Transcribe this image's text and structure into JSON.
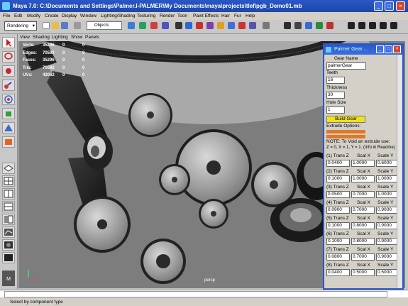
{
  "window": {
    "title": "Maya 7.0: C:\\Documents and Settings\\Palmer.I-PALMER\\My Documents\\maya\\projects\\tlef\\pgb_Demo01.mb"
  },
  "menubar": [
    "File",
    "Edit",
    "Modify",
    "Create",
    "Display",
    "Window",
    "Lighting/Shading",
    "Texturing",
    "Render",
    "Toon",
    "Paint Effects",
    "Hair",
    "Fur",
    "Help"
  ],
  "shelf": {
    "mode": "Rendering",
    "selection_field": "Objects"
  },
  "viewport": {
    "menu": [
      "View",
      "Shading",
      "Lighting",
      "Show",
      "Panels"
    ],
    "hud": [
      {
        "label": "Verts:",
        "v1": "35296",
        "v2": "0",
        "v3": "0"
      },
      {
        "label": "Edges:",
        "v1": "70592",
        "v2": "0",
        "v3": "0"
      },
      {
        "label": "Faces:",
        "v1": "35296",
        "v2": "0",
        "v3": "0"
      },
      {
        "label": "Tris:",
        "v1": "70592",
        "v2": "0",
        "v3": "0"
      },
      {
        "label": "UVs:",
        "v1": "42062",
        "v2": "0",
        "v3": "0"
      }
    ],
    "camera": "persp"
  },
  "gear_window": {
    "title": "Palmer Gear ...",
    "gear_name_label": "Gear Name",
    "gear_name_value": "palmerGear",
    "teeth_label": "Teeth",
    "teeth_value": "16",
    "thickness_label": "Thickness",
    "thickness_value": "30",
    "hole_size_label": "Hole Size",
    "hole_size_value": "1",
    "build_button": "Build Gear",
    "extrude_label": "Extrude Options:",
    "note_line1": "NOTE: To Void an extrude use:",
    "note_line2": "Z = 0, X = 1, Y = 1. (Info in Readme)",
    "col_x": "Scal X",
    "col_y": "Scale Y",
    "extrudes": [
      {
        "label": "(1) Trans Z",
        "z": "0.0400",
        "x": "1.0000",
        "y": "0.6000"
      },
      {
        "label": "(2) Trans Z",
        "z": "0.1000",
        "x": "1.0000",
        "y": "1.0000"
      },
      {
        "label": "(3) Trans Z",
        "z": "0.0500",
        "x": "0.7000",
        "y": "1.0000"
      },
      {
        "label": "(4) Trans Z",
        "z": "0.0900",
        "x": "0.7000",
        "y": "0.9000"
      },
      {
        "label": "(5) Trans Z",
        "z": "0.1000",
        "x": "0.8000",
        "y": "0.9000"
      },
      {
        "label": "(6) Trans Z",
        "z": "0.1000",
        "x": "0.8000",
        "y": "0.9000"
      },
      {
        "label": "(7) Trans Z",
        "z": "0.0800",
        "x": "0.7000",
        "y": "0.9000"
      },
      {
        "label": "(8) Trans Z",
        "z": "0.0400",
        "x": "0.5000",
        "y": "0.5000"
      }
    ]
  },
  "status": {
    "text": "Select by component type"
  }
}
